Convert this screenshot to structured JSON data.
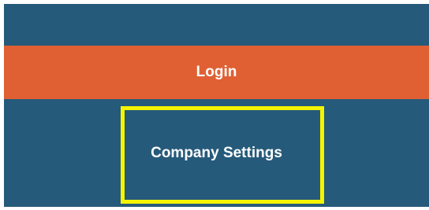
{
  "menu": {
    "login_label": "Login",
    "company_settings_label": "Company Settings"
  },
  "colors": {
    "background": "#265A7A",
    "login_accent": "#E06034",
    "highlight": "#F5F400",
    "text": "#FFFFFF"
  }
}
